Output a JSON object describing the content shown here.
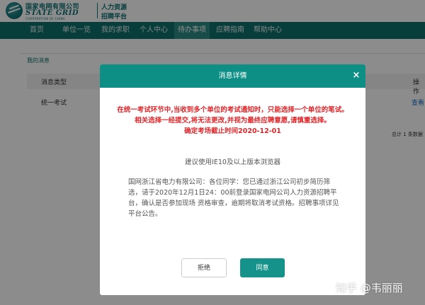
{
  "header": {
    "brand_cn": "国家电网有限公司",
    "brand_en": "STATE GRID",
    "brand_sub": "CORPORATION OF CHINA",
    "platform_line1": "人力资源",
    "platform_line2": "招聘平台"
  },
  "nav": {
    "items": [
      "首页",
      "单位一览",
      "我的求职",
      "个人中心",
      "待办事项",
      "应聘指南",
      "帮助中心"
    ],
    "active_index": 4
  },
  "content": {
    "panel_title": "我的消息",
    "col_type": "消息类型",
    "col_op": "操作",
    "row_type": "统一考试",
    "row_op": "查看",
    "total_text": "总计 1 条数据"
  },
  "modal": {
    "title": "消息详情",
    "close": "×",
    "warning_line1": "在统一考试环节中,当收到多个单位的考试通知时，只能选择一个单位的笔试。",
    "warning_line2": "相关选择一经提交,将无法更改,并视为最终应聘意愿,请慎重选择。",
    "warning_line3": "确定考场截止时间2020-12-01",
    "browser_tip": "建议使用IE10及以上版本浏览器",
    "notice": "国网浙江省电力有限公司：各位同学：您已通过浙江公司初步简历筛选，请于2020年12月1日24：00前登录国家电网公司人力资源招聘平台，确认是否参加现场 资格审查，逾期将取消考试资格。招聘事项详见平台公告。",
    "reject_label": "拒绝",
    "agree_label": "同意"
  },
  "watermark": "知乎 @韦丽丽",
  "colors": {
    "brand": "#0e6f6c",
    "modal_header": "#0d8f86",
    "warning": "#e0262a",
    "agree_button": "#15928a"
  }
}
